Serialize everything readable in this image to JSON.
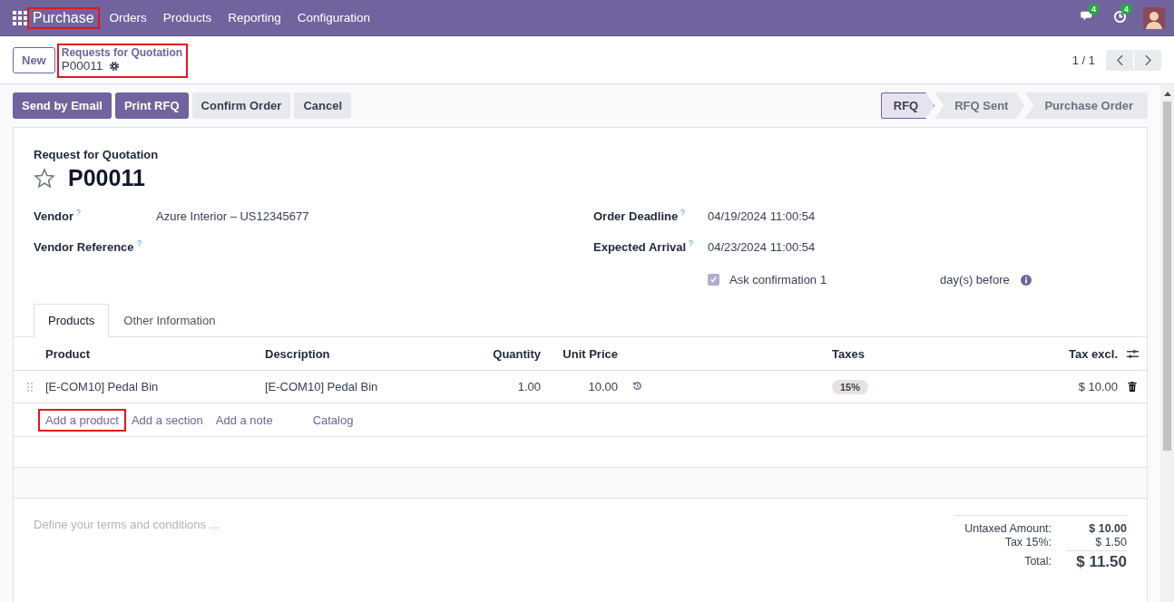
{
  "navbar": {
    "app": {
      "label": "Purchase",
      "highlighted": true
    },
    "menus": [
      "Orders",
      "Products",
      "Reporting",
      "Configuration"
    ],
    "indicators": [
      {
        "kind": "chat",
        "count": "4"
      },
      {
        "kind": "activity",
        "count": "4"
      }
    ]
  },
  "control_panel": {
    "new_button": "New",
    "breadcrumb": {
      "parent": "Requests for Quotation",
      "current": "P00011",
      "highlighted": true
    },
    "pager": "1 / 1"
  },
  "actions": [
    {
      "label": "Send by Email",
      "kind": "primary"
    },
    {
      "label": "Print RFQ",
      "kind": "primary"
    },
    {
      "label": "Confirm Order",
      "kind": "secondary"
    },
    {
      "label": "Cancel",
      "kind": "secondary"
    }
  ],
  "status_steps": [
    {
      "label": "RFQ",
      "selected": true
    },
    {
      "label": "RFQ Sent",
      "selected": false
    },
    {
      "label": "Purchase Order",
      "selected": false
    }
  ],
  "form": {
    "subtitle": "Request for Quotation",
    "title": "P00011",
    "starred": false,
    "left_fields": [
      {
        "label": "Vendor",
        "value": "Azure Interior – US12345677"
      },
      {
        "label": "Vendor Reference"
      }
    ],
    "right_fields": [
      {
        "label": "Order Deadline",
        "value": "04/19/2024 11:00:54"
      },
      {
        "label": "Expected Arrival",
        "value": "04/23/2024 11:00:54"
      }
    ],
    "ask_confirmation": {
      "label": "Ask confirmation",
      "checked": true,
      "days": "1",
      "suffix": "day(s) before"
    }
  },
  "tabs": [
    {
      "label": "Products",
      "selected": true
    },
    {
      "label": "Other Information",
      "selected": false
    }
  ],
  "table": {
    "columns": [
      "Product",
      "Description",
      "Quantity",
      "Unit Price",
      "Taxes",
      "Tax excl."
    ],
    "rows": [
      {
        "product": "[E-COM10] Pedal Bin",
        "description": "[E-COM10] Pedal Bin",
        "quantity": "1.00",
        "unit_price": "10.00",
        "tax": "15%",
        "subtotal": "$ 10.00"
      }
    ],
    "add_links": [
      {
        "label": "Add a product",
        "highlighted": true
      },
      {
        "label": "Add a section",
        "highlighted": false
      },
      {
        "label": "Add a note",
        "highlighted": false
      },
      {
        "label": "Catalog",
        "highlighted": false
      }
    ]
  },
  "terms": {
    "placeholder": "Define your terms and conditions ..."
  },
  "totals": [
    {
      "label": "Untaxed Amount:",
      "value": "$ 10.00",
      "kind": "untaxed"
    },
    {
      "label": "Tax 15%:",
      "value": "$ 1.50",
      "kind": "tax"
    },
    {
      "label": "Total:",
      "value": "$ 11.50",
      "kind": "total"
    }
  ]
}
